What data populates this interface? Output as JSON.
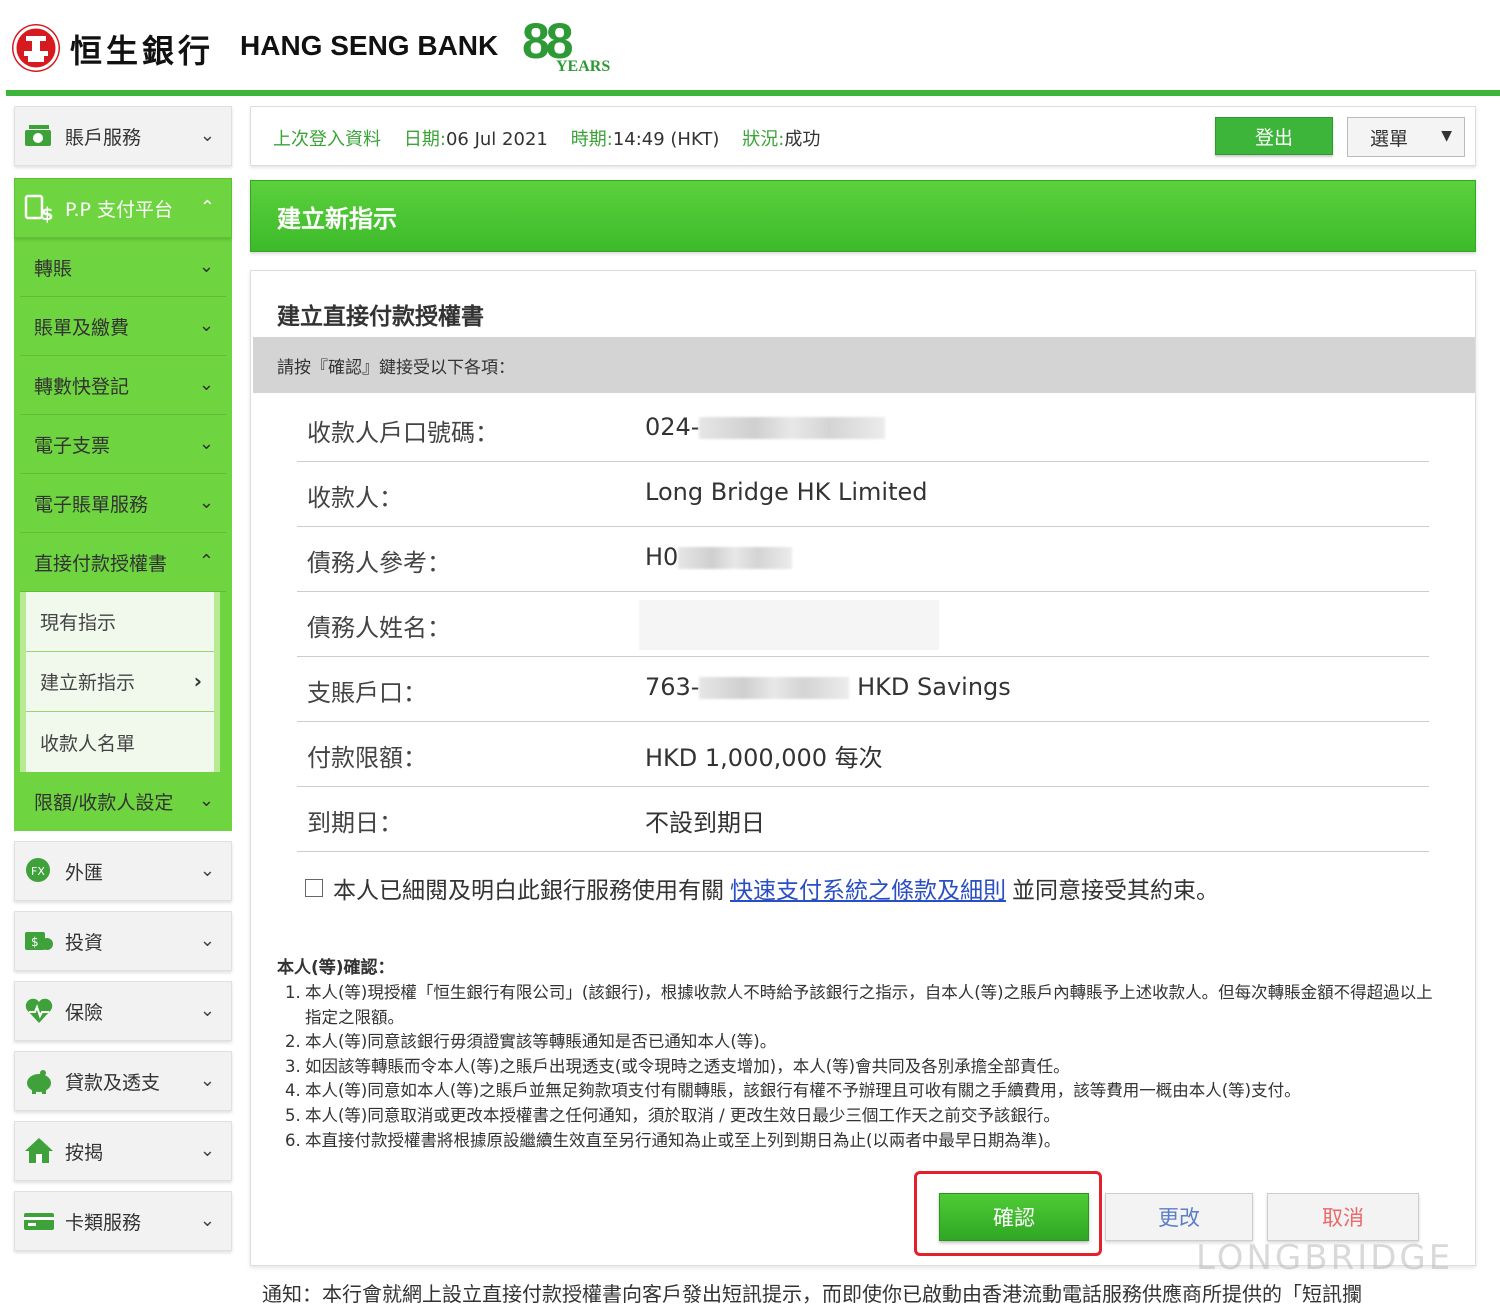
{
  "header": {
    "bank_name_cn": "恒生銀行",
    "bank_name_en": "HANG SENG BANK",
    "anniversary_number": "88",
    "anniversary_text": "YEARS"
  },
  "sidebar": {
    "items": [
      {
        "label": "賬戶服務",
        "icon": "account-icon"
      },
      {
        "label": "P.P 支付平台",
        "icon": "payment-icon"
      },
      {
        "label": "外匯",
        "icon": "fx-icon"
      },
      {
        "label": "投資",
        "icon": "investment-icon"
      },
      {
        "label": "保險",
        "icon": "insurance-icon"
      },
      {
        "label": "貸款及透支",
        "icon": "piggy-bank-icon"
      },
      {
        "label": "按揭",
        "icon": "house-icon"
      },
      {
        "label": "卡類服務",
        "icon": "card-icon"
      }
    ],
    "pp_subitems": [
      "轉賬",
      "賬單及繳費",
      "轉數快登記",
      "電子支票",
      "電子賬單服務",
      "直接付款授權書"
    ],
    "direct_debit_subitems": [
      "現有指示",
      "建立新指示",
      "收款人名單"
    ],
    "limit_item": "限額/收款人設定"
  },
  "topbar": {
    "last_login_label": "上次登入資料",
    "date_label": "日期:",
    "date_value": "06 Jul 2021",
    "time_label": "時期:",
    "time_value": "14:49 (HKT)",
    "status_label": "狀況:",
    "status_value": "成功",
    "logout_label": "登出",
    "menu_label": "選單"
  },
  "page_title": "建立新指示",
  "panel": {
    "title": "建立直接付款授權書",
    "instruction": "請按『確認』鍵接受以下各項：",
    "rows": [
      {
        "label": "收款人戶口號碼：",
        "value": "024-"
      },
      {
        "label": "收款人：",
        "value": "Long Bridge HK Limited"
      },
      {
        "label": "債務人參考：",
        "value": "H0"
      },
      {
        "label": "債務人姓名：",
        "value": ""
      },
      {
        "label": "支賬戶口：",
        "value": "763-",
        "suffix": "HKD Savings"
      },
      {
        "label": "付款限額：",
        "value": "HKD 1,000,000 每次"
      },
      {
        "label": "到期日：",
        "value": "不設到期日"
      }
    ],
    "agree_prefix": "本人已細閱及明白此銀行服務使用有關",
    "agree_link": "快速支付系統之條款及細則",
    "agree_suffix": "並同意接受其約束。",
    "confirm_heading": "本人(等)確認：",
    "terms": [
      "本人(等)現授權「恒生銀行有限公司」(該銀行)，根據收款人不時給予該銀行之指示，自本人(等)之賬戶內轉賬予上述收款人。但每次轉賬金額不得超過以上指定之限額。",
      "本人(等)同意該銀行毋須證實該等轉賬通知是否已通知本人(等)。",
      "如因該等轉賬而令本人(等)之賬戶出現透支(或令現時之透支增加)，本人(等)會共同及各別承擔全部責任。",
      "本人(等)同意如本人(等)之賬戶並無足夠款項支付有關轉賬，該銀行有權不予辦理且可收有關之手續費用，該等費用一概由本人(等)支付。",
      "本人(等)同意取消或更改本授權書之任何通知，須於取消 / 更改生效日最少三個工作天之前交予該銀行。",
      "本直接付款授權書將根據原設繼續生效直至另行通知為止或至上列到期日為止(以兩者中最早日期為準)。"
    ],
    "term_numbers": [
      "1.",
      "2.",
      "3.",
      "4.",
      "5.",
      "6."
    ],
    "confirm_label": "確認",
    "edit_label": "更改",
    "cancel_label": "取消"
  },
  "notice": "通知：本行會就網上設立直接付款授權書向客戶發出短訊提示，而即使你已啟動由香港流動電話服務供應商所提供的「短訊攔",
  "watermark": "LONGBRIDGE",
  "colors": {
    "brand_green": "#3db53a",
    "brand_red": "#d71920",
    "highlight_red": "#e3212c",
    "link_blue": "#2a4fc4"
  }
}
